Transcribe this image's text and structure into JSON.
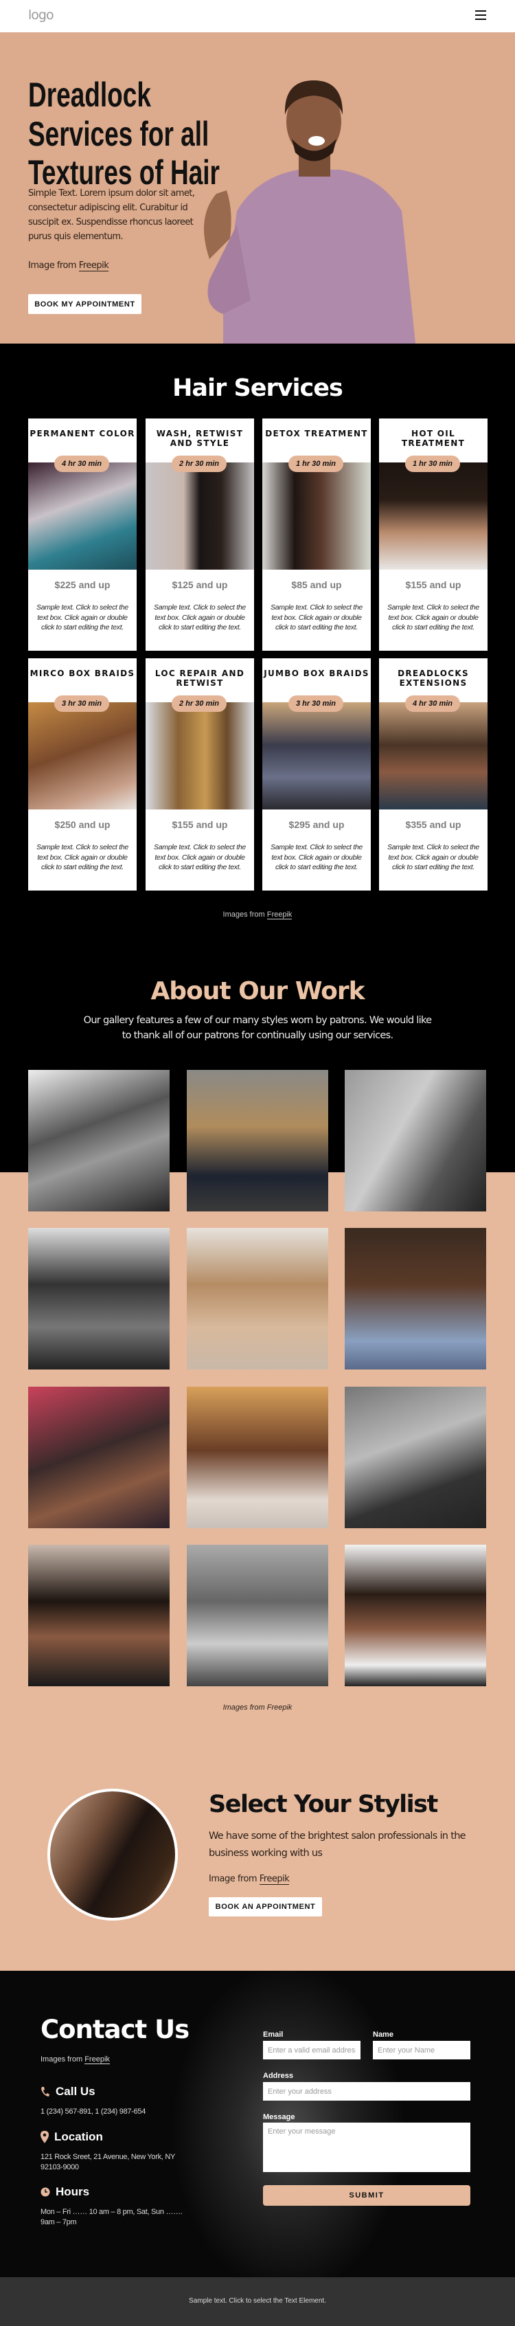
{
  "header": {
    "logo": "logo",
    "menu_icon": "hamburger-icon"
  },
  "hero": {
    "title_lines": [
      "Dreadlock",
      "Services for all",
      "Textures of Hair"
    ],
    "text": "Simple Text. Lorem ipsum dolor sit amet, consectetur adipiscing elit. Curabitur id suscipit ex. Suspendisse rhoncus laoreet purus quis elementum.",
    "credit_prefix": "Image from",
    "credit_link": "Freepik",
    "button": "BOOK MY APPOINTMENT"
  },
  "services": {
    "title": "Hair Services",
    "cards": [
      {
        "title": "PERMANENT COLOR",
        "duration": "4 hr 30 min",
        "price": "$225 and up",
        "text": "Sample text. Click to select the text box. Click again or double click to start editing the text."
      },
      {
        "title": "WASH, RETWIST AND STYLE",
        "duration": "2 hr 30 min",
        "price": "$125 and up",
        "text": "Sample text. Click to select the text box. Click again or double click to start editing the text."
      },
      {
        "title": "DETOX TREATMENT",
        "duration": "1 hr 30 min",
        "price": "$85 and up",
        "text": "Sample text. Click to select the text box. Click again or double click to start editing the text."
      },
      {
        "title": "HOT OIL TREATMENT",
        "duration": "1 hr 30 min",
        "price": "$155 and up",
        "text": "Sample text. Click to select the text box. Click again or double click to start editing the text."
      },
      {
        "title": "MIRCO BOX BRAIDS",
        "duration": "3 hr 30 min",
        "price": "$250 and up",
        "text": "Sample text. Click to select the text box. Click again or double click to start editing the text."
      },
      {
        "title": "LOC REPAIR AND RETWIST",
        "duration": "2 hr 30 min",
        "price": "$155 and up",
        "text": "Sample text. Click to select the text box. Click again or double click to start editing the text."
      },
      {
        "title": "JUMBO BOX BRAIDS",
        "duration": "3 hr 30 min",
        "price": "$295 and up",
        "text": "Sample text. Click to select the text box. Click again or double click to start editing the text."
      },
      {
        "title": "DREADLOCKS EXTENSIONS",
        "duration": "4 hr 30 min",
        "price": "$355 and up",
        "text": "Sample text. Click to select the text box. Click again or double click to start editing the text."
      }
    ],
    "credit_prefix": "Images from",
    "credit_link": "Freepik"
  },
  "about": {
    "title": "About Our Work",
    "text": "Our gallery features a few of our many styles worn by patrons. We would like to thank all of our patrons for continually using our services.",
    "credit": "Images from Freepik"
  },
  "stylist": {
    "title": "Select Your Stylist",
    "text": "We have some of the brightest salon professionals in the business working with us",
    "credit_prefix": "Image from",
    "credit_link": "Freepik",
    "button": "BOOK AN APPOINTMENT"
  },
  "contact": {
    "title": "Contact Us",
    "credit_prefix": "Images from",
    "credit_link": "Freepik",
    "call_heading": "Call Us",
    "phones": "1 (234) 567-891, 1 (234) 987-654",
    "location_heading": "Location",
    "address": "121 Rock Sreet, 21 Avenue, New York, NY 92103-9000",
    "hours_heading": "Hours",
    "hours": "Mon – Fri …… 10 am – 8 pm, Sat, Sun ……. 9am – 7pm",
    "form": {
      "email_label": "Email",
      "email_placeholder": "Enter a valid email address",
      "name_label": "Name",
      "name_placeholder": "Enter your Name",
      "address_label": "Address",
      "address_placeholder": "Enter your address",
      "message_label": "Message",
      "message_placeholder": "Enter your message",
      "submit": "SUBMIT"
    }
  },
  "footer": {
    "text": "Sample text. Click to select the Text Element."
  },
  "colors": {
    "hero_bg": "#dcaa8c",
    "accent": "#e6b99d",
    "badge": "#e4b497",
    "about_title": "#ecc3a5",
    "dark": "#000000",
    "footer_bg": "#333333"
  }
}
